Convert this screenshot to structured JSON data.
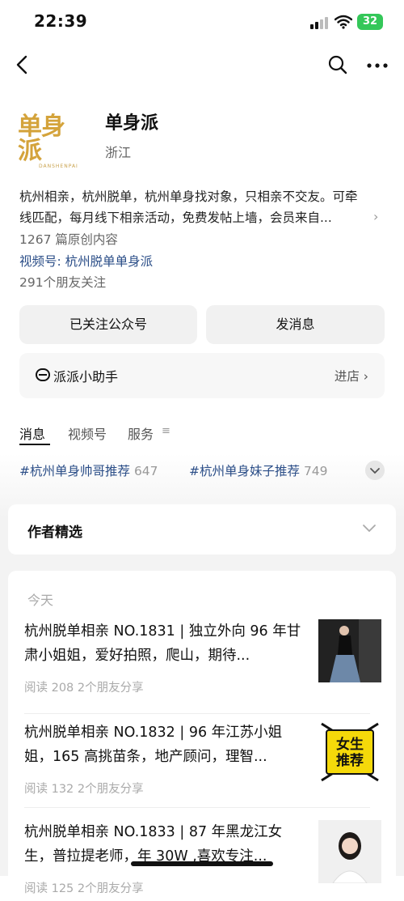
{
  "status_bar": {
    "time": "22:39",
    "battery": "32"
  },
  "profile": {
    "logo_text": "单身派",
    "logo_sub": "DANSHENPAI",
    "name": "单身派",
    "region": "浙江",
    "description": "杭州相亲，杭州脱单，杭州单身找对象，只相亲不交友。可牵线匹配，每月线下相亲活动，免费发帖上墙，会员来自...",
    "articles": "1267 篇原创内容",
    "channel": "视频号: 杭州脱单单身派",
    "friends": "291个朋友关注"
  },
  "buttons": {
    "follow": "已关注公众号",
    "message": "发消息"
  },
  "assistant": {
    "label": "派派小助手",
    "enter": "进店"
  },
  "tabs": [
    "消息",
    "视频号",
    "服务"
  ],
  "tags": [
    {
      "label": "#杭州单身帅哥推荐",
      "count": "647"
    },
    {
      "label": "#杭州单身妹子推荐",
      "count": "749"
    }
  ],
  "picks": {
    "title": "作者精选"
  },
  "feed": {
    "date_label": "今天",
    "items": [
      {
        "title": "杭州脱单相亲 NO.1831 | 独立外向 96 年甘肃小姐姐，爱好拍照，爬山，期待...",
        "meta": "阅读 208  2个朋友分享"
      },
      {
        "title": "杭州脱单相亲 NO.1832 | 96 年江苏小姐姐，165 高挑苗条，地产顾问，理智...",
        "meta": "阅读 132  2个朋友分享",
        "thumb_text_1": "女生",
        "thumb_text_2": "推荐"
      },
      {
        "title": "杭州脱单相亲 NO.1833 | 87 年黑龙江女生，普拉提老师，年 30W ,喜欢专注...",
        "meta": "阅读 125  2个朋友分享"
      }
    ]
  },
  "icons": {
    "back": "back-arrow-icon",
    "search": "search-icon",
    "more": "more-icon",
    "assistant": "assistant-icon",
    "chevron": "chevron-down-icon"
  },
  "colors": {
    "link": "#2a4d87",
    "battery": "#34c759",
    "logo": "#d4a33b",
    "thumb_badge": "#f5d90a"
  }
}
